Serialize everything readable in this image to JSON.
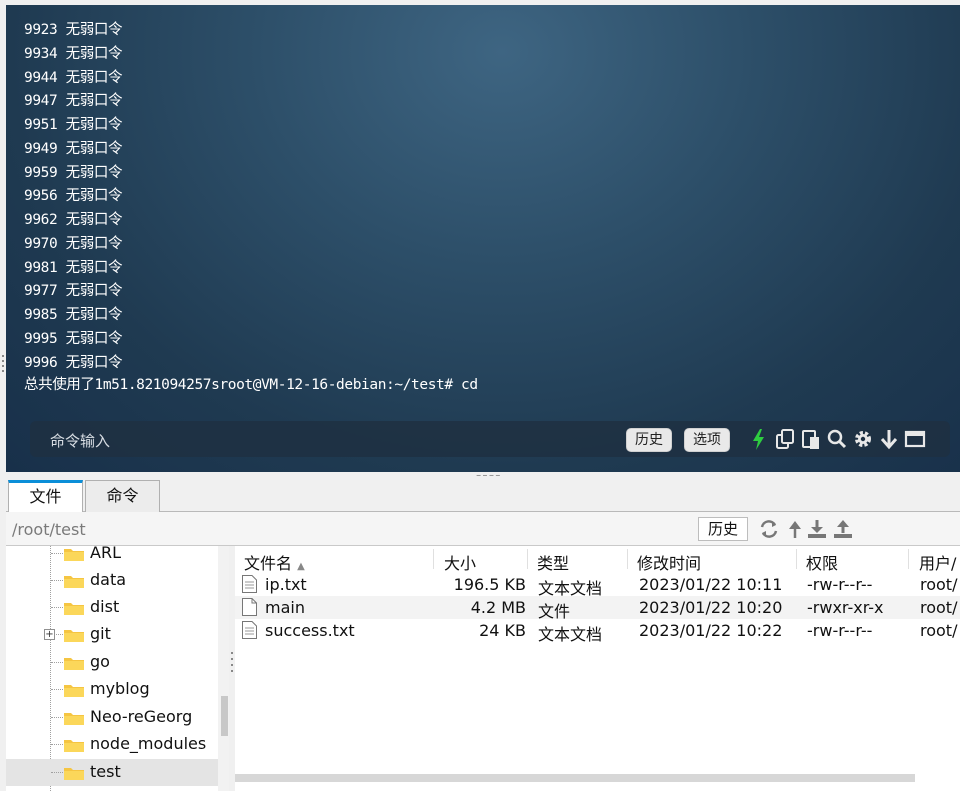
{
  "terminal": {
    "lines": [
      "9923 无弱口令",
      "9934 无弱口令",
      "9944 无弱口令",
      "9947 无弱口令",
      "9951 无弱口令",
      "9949 无弱口令",
      "9959 无弱口令",
      "9956 无弱口令",
      "9962 无弱口令",
      "9970 无弱口令",
      "9981 无弱口令",
      "9977 无弱口令",
      "9985 无弱口令",
      "9995 无弱口令",
      "9996 无弱口令"
    ],
    "last_line": "总共使用了1m51.821094257sroot@VM-12-16-debian:~/test# cd",
    "command_placeholder": "命令输入",
    "history_button": "历史",
    "options_button": "选项",
    "icons": [
      "lightning-icon",
      "copy-icon",
      "paste-icon",
      "search-icon",
      "gear-icon",
      "arrow-down-icon",
      "window-icon"
    ],
    "lightning_color": "#2ecc40"
  },
  "tabs": [
    {
      "label": "文件",
      "active": true
    },
    {
      "label": "命令",
      "active": false
    }
  ],
  "pathbar": {
    "path": "/root/test",
    "history_button": "历史",
    "icons": [
      "refresh-icon",
      "up-arrow-icon",
      "download-icon",
      "upload-icon"
    ]
  },
  "tree": {
    "items": [
      {
        "label": "ARL",
        "expandable": false,
        "selected": false
      },
      {
        "label": "data",
        "expandable": false,
        "selected": false
      },
      {
        "label": "dist",
        "expandable": false,
        "selected": false
      },
      {
        "label": "git",
        "expandable": true,
        "selected": false
      },
      {
        "label": "go",
        "expandable": false,
        "selected": false
      },
      {
        "label": "myblog",
        "expandable": false,
        "selected": false
      },
      {
        "label": "Neo-reGeorg",
        "expandable": false,
        "selected": false
      },
      {
        "label": "node_modules",
        "expandable": false,
        "selected": false
      },
      {
        "label": "test",
        "expandable": false,
        "selected": true
      }
    ]
  },
  "filelist": {
    "columns": [
      "文件名",
      "大小",
      "类型",
      "修改时间",
      "权限",
      "用户/"
    ],
    "sort_indicator": "▲",
    "rows": [
      {
        "name": "ip.txt",
        "size": "196.5 KB",
        "type": "文本文档",
        "mtime": "2023/01/22 10:11",
        "perm": "-rw-r--r--",
        "user": "root/"
      },
      {
        "name": "main",
        "size": "4.2 MB",
        "type": "文件",
        "mtime": "2023/01/22 10:20",
        "perm": "-rwxr-xr-x",
        "user": "root/"
      },
      {
        "name": "success.txt",
        "size": "24 KB",
        "type": "文本文档",
        "mtime": "2023/01/22 10:22",
        "perm": "-rw-r--r--",
        "user": "root/"
      }
    ]
  }
}
